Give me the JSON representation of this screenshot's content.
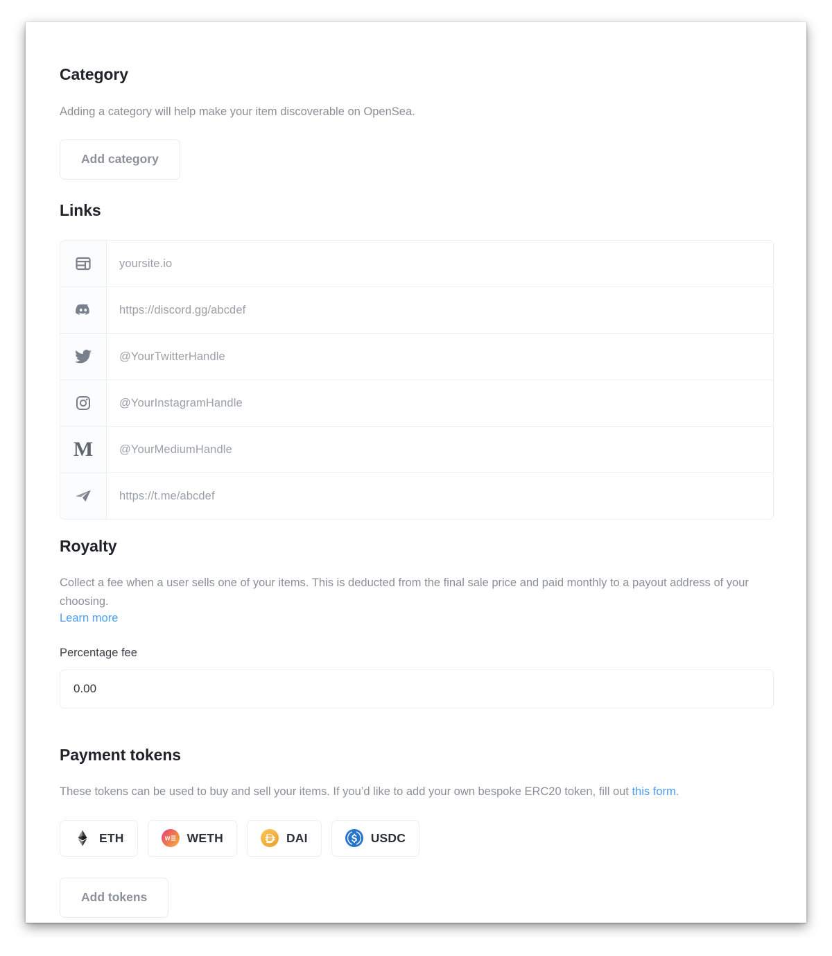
{
  "category": {
    "title": "Category",
    "description": "Adding a category will help make your item discoverable on OpenSea.",
    "add_button_label": "Add category"
  },
  "links": {
    "title": "Links",
    "rows": [
      {
        "icon": "website-icon",
        "value": "yoursite.io"
      },
      {
        "icon": "discord-icon",
        "value": "https://discord.gg/abcdef"
      },
      {
        "icon": "twitter-icon",
        "value": "@YourTwitterHandle"
      },
      {
        "icon": "instagram-icon",
        "value": "@YourInstagramHandle"
      },
      {
        "icon": "medium-icon",
        "value": "@YourMediumHandle"
      },
      {
        "icon": "telegram-icon",
        "value": "https://t.me/abcdef"
      }
    ]
  },
  "royalty": {
    "title": "Royalty",
    "description": "Collect a fee when a user sells one of your items. This is deducted from the final sale price and paid monthly to a payout address of your choosing.",
    "learn_more_label": "Learn more",
    "percentage_fee_label": "Percentage fee",
    "percentage_fee_value": "0.00",
    "percentage_fee_placeholder": "0.00"
  },
  "payment_tokens": {
    "title": "Payment tokens",
    "description_part1": "These tokens can be used to buy and sell your items. If you’d like to add your own bespoke ERC20 token, fill out ",
    "description_link": "this form",
    "description_part2": ".",
    "tokens": [
      {
        "symbol": "ETH",
        "icon": "eth-icon",
        "color": "#3c3c3d"
      },
      {
        "symbol": "WETH",
        "icon": "weth-icon",
        "color": "#e8486a"
      },
      {
        "symbol": "DAI",
        "icon": "dai-icon",
        "color": "#f5ac37"
      },
      {
        "symbol": "USDC",
        "icon": "usdc-icon",
        "color": "#2775ca"
      }
    ],
    "add_button_label": "Add tokens"
  },
  "theme": {
    "accent_link": "#4a9df0",
    "heading": "#21232a",
    "muted_text": "#8a8f98",
    "border": "#eceef1"
  }
}
